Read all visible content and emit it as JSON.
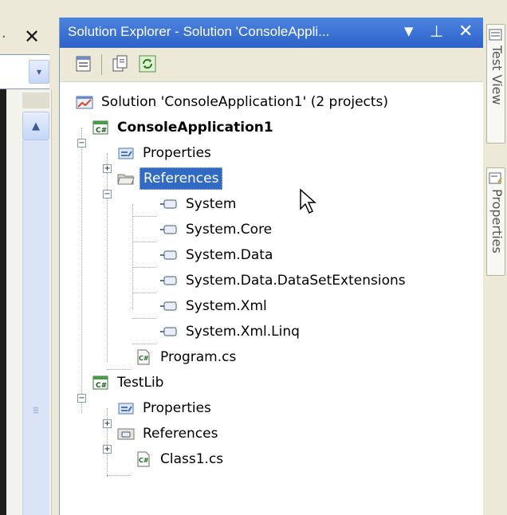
{
  "left_pane": {
    "close_glyph": "✕",
    "pin_glyph": "·",
    "combo_arrow": "▾",
    "scroll_up_arrow": "▲"
  },
  "solution_explorer": {
    "title": "Solution Explorer - Solution 'ConsoleAppli...",
    "title_dropdown_glyph": "▼",
    "title_pin_glyph": "⊥",
    "title_close_glyph": "✕",
    "toolbar": [
      "properties-button",
      "show-all-files-button",
      "refresh-button"
    ],
    "tree": {
      "solution": "Solution 'ConsoleApplication1' (2 projects)",
      "project1": {
        "name": "ConsoleApplication1",
        "properties": "Properties",
        "references": "References",
        "refs": [
          "System",
          "System.Core",
          "System.Data",
          "System.Data.DataSetExtensions",
          "System.Xml",
          "System.Xml.Linq"
        ],
        "program": "Program.cs"
      },
      "project2": {
        "name": "TestLib",
        "properties": "Properties",
        "references": "References",
        "class1": "Class1.cs"
      }
    },
    "selected_item": "References"
  },
  "right_strip": {
    "tabs": [
      "Test View",
      "Properties"
    ]
  },
  "colors": {
    "title_bar": "#3c78d8",
    "selection": "#316ac5",
    "chrome": "#ece9d8"
  }
}
